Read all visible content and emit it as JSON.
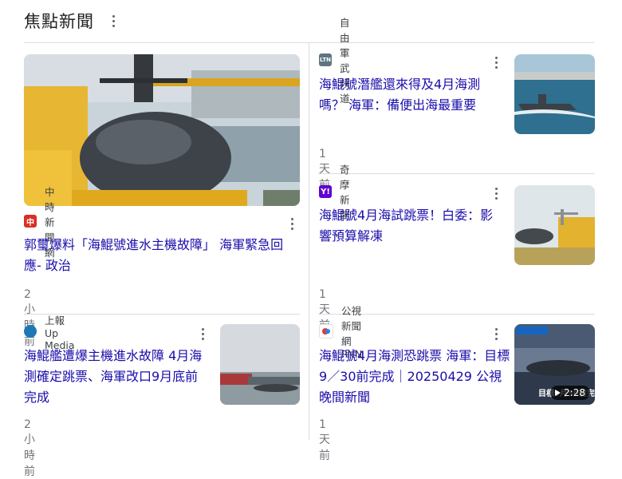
{
  "header": {
    "title": "焦點新聞"
  },
  "cards": [
    {
      "source": "中時新聞網",
      "headline": "郭璽爆料「海鯤號進水主機故障」 海軍緊急回應- 政治",
      "time": "2 小時前"
    },
    {
      "source": "自由軍武頻道",
      "headline": "海鯤號潛艦還來得及4月海測嗎？ 海軍：備便出海最重要",
      "time": "1 天前"
    },
    {
      "source": "奇摩新聞",
      "headline": "海鯤號4月海試跳票！白委：影響預算解凍",
      "time": "1 天前"
    },
    {
      "source": "上報Up Media",
      "headline": "海鯤艦遭爆主機進水故障 4月海測確定跳票、海軍改口9月底前完成",
      "time": "2 小時前"
    },
    {
      "source": "公視新聞網PNN",
      "headline": "海鯤號4月海測恐跳票 海軍：目標9／30前完成｜20250429 公視晚間新聞",
      "time": "1 天前",
      "video_duration": "2:28",
      "thumb_caption": "目標9月30前完"
    }
  ],
  "logos": {
    "chinatimes": "中",
    "ltn": "LTN",
    "yahoo": "Y!"
  },
  "colors": {
    "link": "#1a0dab",
    "meta": "#70757a",
    "divider": "#dadce0"
  }
}
